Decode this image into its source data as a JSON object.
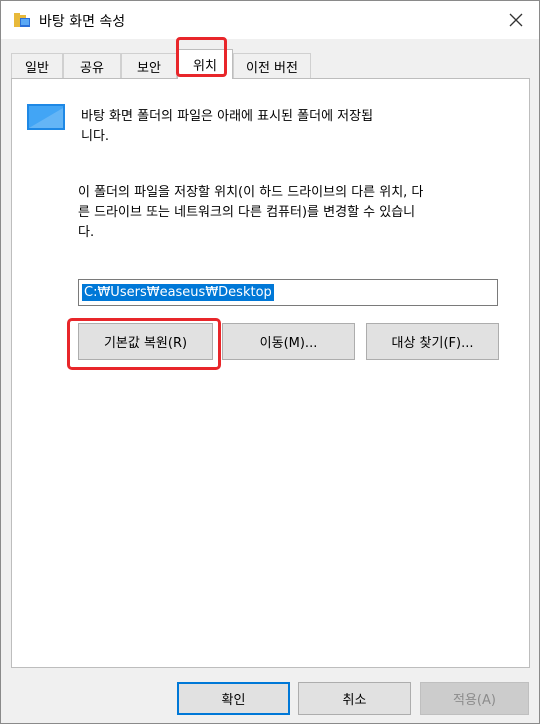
{
  "window": {
    "title": "바탕 화면 속성"
  },
  "tabs": [
    {
      "label": "일반"
    },
    {
      "label": "공유"
    },
    {
      "label": "보안"
    },
    {
      "label": "위치"
    },
    {
      "label": "이전 버전"
    }
  ],
  "active_tab": "위치",
  "location": {
    "description_line1": "바탕 화면 폴더의 파일은 아래에 표시된 폴더에 저장됩",
    "description_line2": "니다.",
    "instruction_line1": "이 폴더의 파일을 저장할 위치(이 하드 드라이브의 다른 위치, 다",
    "instruction_line2": "른 드라이브 또는 네트워크의 다른 컴퓨터)를 변경할 수 있습니",
    "instruction_line3": "다.",
    "path_value": "C:₩Users₩easeus₩Desktop",
    "restore_default_label": "기본값 복원(R)",
    "move_label": "이동(M)...",
    "find_target_label": "대상 찾기(F)..."
  },
  "footer": {
    "ok_label": "확인",
    "cancel_label": "취소",
    "apply_label": "적용(A)"
  },
  "colors": {
    "highlight": "#e8262a",
    "accent": "#0078d7"
  }
}
